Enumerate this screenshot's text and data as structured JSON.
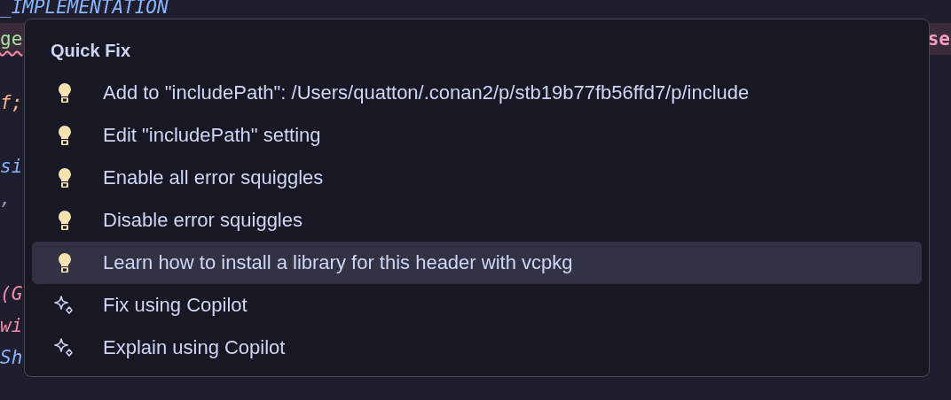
{
  "editor": {
    "lines": [
      {
        "kind": "code",
        "text": "_IMPLEMENTATION",
        "color": "#89b4fa",
        "error": false
      },
      {
        "kind": "code",
        "text": "ge",
        "color": "#a6e3a1",
        "error": true,
        "tail": "se"
      },
      {
        "kind": "blank"
      },
      {
        "kind": "code",
        "text": "f;",
        "color": "#fab387",
        "error": false
      },
      {
        "kind": "blank"
      },
      {
        "kind": "code",
        "text": "si",
        "color": "#89b4fa",
        "error": false
      },
      {
        "kind": "code",
        "text": ",",
        "color": "#9399b2",
        "error": false
      },
      {
        "kind": "blank"
      },
      {
        "kind": "blank"
      },
      {
        "kind": "code",
        "text": "(G",
        "color": "#f38ba8",
        "error": false
      },
      {
        "kind": "code",
        "text": "wi",
        "color": "#f38ba8",
        "error": false
      },
      {
        "kind": "code",
        "text": "Sh",
        "color": "#89b4fa",
        "error": false
      }
    ]
  },
  "quick_fix": {
    "title": "Quick Fix",
    "items": [
      {
        "kind": "lightbulb",
        "label": "Add to \"includePath\": /Users/quatton/.conan2/p/stb19b77fb56ffd7/p/include",
        "selected": false
      },
      {
        "kind": "lightbulb",
        "label": "Edit \"includePath\" setting",
        "selected": false
      },
      {
        "kind": "lightbulb",
        "label": "Enable all error squiggles",
        "selected": false
      },
      {
        "kind": "lightbulb",
        "label": "Disable error squiggles",
        "selected": false
      },
      {
        "kind": "lightbulb",
        "label": "Learn how to install a library for this header with vcpkg",
        "selected": true
      },
      {
        "kind": "copilot",
        "label": "Fix using Copilot",
        "selected": false
      },
      {
        "kind": "copilot",
        "label": "Explain using Copilot",
        "selected": false
      }
    ]
  }
}
